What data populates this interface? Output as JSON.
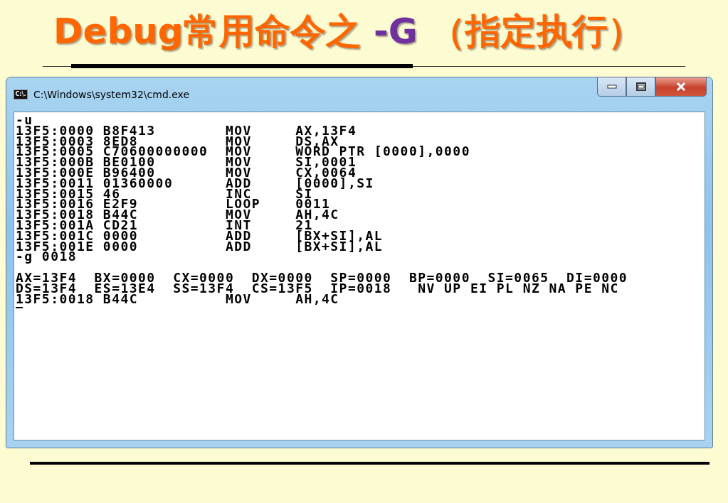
{
  "slide": {
    "title_parts": [
      {
        "text": "Debug常用命令之 ",
        "color": "#ff6600"
      },
      {
        "text": "-G",
        "color": "#7030a0"
      },
      {
        "text": " （指定执行）",
        "color": "#ff6600"
      }
    ]
  },
  "window": {
    "title": "C:\\Windows\\system32\\cmd.exe",
    "icon_text": "C:\\."
  },
  "console": {
    "blocks": [
      [
        "-u",
        "13F5:0000 B8F413        MOV     AX,13F4",
        "13F5:0003 8ED8          MOV     DS,AX",
        "13F5:0005 C70600000000  MOV     WORD PTR [0000],0000",
        "13F5:000B BE0100        MOV     SI,0001",
        "13F5:000E B96400        MOV     CX,0064",
        "13F5:0011 01360000      ADD     [0000],SI",
        "13F5:0015 46            INC     SI",
        "13F5:0016 E2F9          LOOP    0011",
        "13F5:0018 B44C          MOV     AH,4C",
        "13F5:001A CD21          INT     21",
        "13F5:001C 0000          ADD     [BX+SI],AL",
        "13F5:001E 0000          ADD     [BX+SI],AL",
        "-g 0018"
      ],
      [
        "AX=13F4  BX=0000  CX=0000  DX=0000  SP=0000  BP=0000  SI=0065  DI=0000",
        "DS=13F4  ES=13E4  SS=13F4  CS=13F5  IP=0018   NV UP EI PL NZ NA PE NC",
        "13F5:0018 B44C          MOV     AH,4C"
      ]
    ],
    "cursor": true
  }
}
